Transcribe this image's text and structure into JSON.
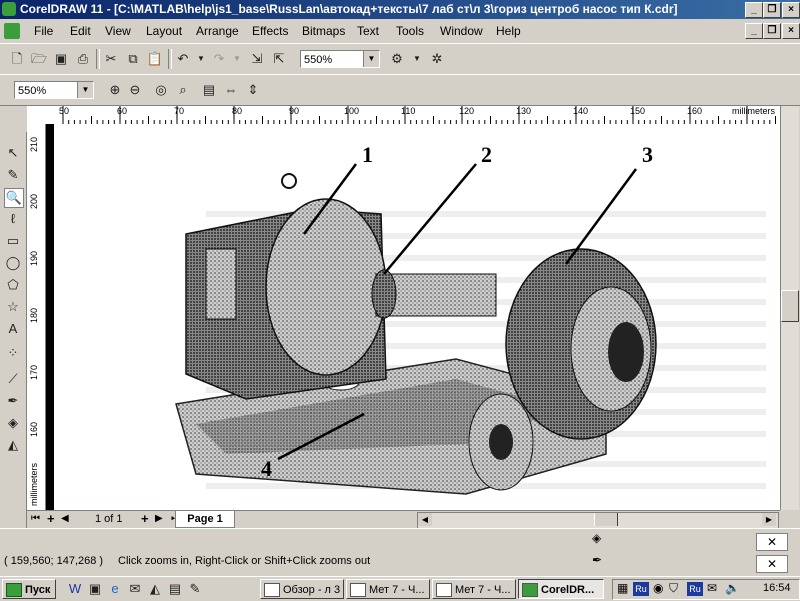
{
  "window": {
    "title": "CorelDRAW 11 - [C:\\MATLAB\\help\\js1_base\\RussLan\\автокад+тексты\\7 лаб ст\\л 3\\гориз центроб насос тип К.cdr]",
    "minimize_glyph": "_",
    "restore_glyph": "❐",
    "close_glyph": "×"
  },
  "menubar": {
    "items": [
      {
        "label": "File"
      },
      {
        "label": "Edit"
      },
      {
        "label": "View"
      },
      {
        "label": "Layout"
      },
      {
        "label": "Arrange"
      },
      {
        "label": "Effects"
      },
      {
        "label": "Bitmaps"
      },
      {
        "label": "Text"
      },
      {
        "label": "Tools"
      },
      {
        "label": "Window"
      },
      {
        "label": "Help"
      }
    ]
  },
  "standard_toolbar": {
    "zoom_value": "550%",
    "icons": [
      "new-icon",
      "open-icon",
      "save-icon",
      "print-icon",
      "cut-icon",
      "copy-icon",
      "paste-icon",
      "undo-icon",
      "redo-icon",
      "import-icon",
      "export-icon",
      "app-launcher-icon",
      "corel-online-icon"
    ]
  },
  "zoom_toolbar": {
    "zoom_value": "550%",
    "icons": [
      "zoom-in-icon",
      "zoom-out-icon",
      "zoom-selected-icon",
      "zoom-all-icon",
      "zoom-page-icon",
      "zoom-width-icon",
      "zoom-height-icon"
    ]
  },
  "rulers": {
    "unit": "millimeters",
    "horizontal_ticks": [
      "50",
      "60",
      "70",
      "80",
      "90",
      "100",
      "110",
      "120",
      "130",
      "140",
      "150",
      "160"
    ],
    "vertical_ticks": [
      "210",
      "200",
      "190",
      "180",
      "170",
      "160"
    ],
    "vertical_unit": "millimeters"
  },
  "toolbox": {
    "tools": [
      "pick-tool-icon",
      "shape-tool-icon",
      "zoom-tool-icon",
      "freehand-tool-icon",
      "rectangle-tool-icon",
      "ellipse-tool-icon",
      "polygon-tool-icon",
      "basic-shapes-icon",
      "text-tool-icon",
      "interactive-blend-icon",
      "eyedropper-icon",
      "outline-tool-icon",
      "fill-tool-icon",
      "interactive-fill-icon"
    ]
  },
  "drawing": {
    "callouts": [
      "1",
      "2",
      "3",
      "4"
    ],
    "background_text_hint": ""
  },
  "page_tabs": {
    "page_counter": "1 of 1",
    "active_tab": "Page 1"
  },
  "statusbar": {
    "coordinates": "( 159,560; 147,268 )",
    "hint": "Click zooms in, Right-Click or Shift+Click zooms out"
  },
  "taskbar": {
    "start_label": "Пуск",
    "tasks": [
      {
        "label": "Обзор - л 3",
        "active": false
      },
      {
        "label": "Мет 7 - Ч...",
        "active": false
      },
      {
        "label": "Мет 7 - Ч...",
        "active": false
      },
      {
        "label": "CorelDR...",
        "active": true
      }
    ],
    "clock": "16:54",
    "lang_badge": "Ru"
  }
}
